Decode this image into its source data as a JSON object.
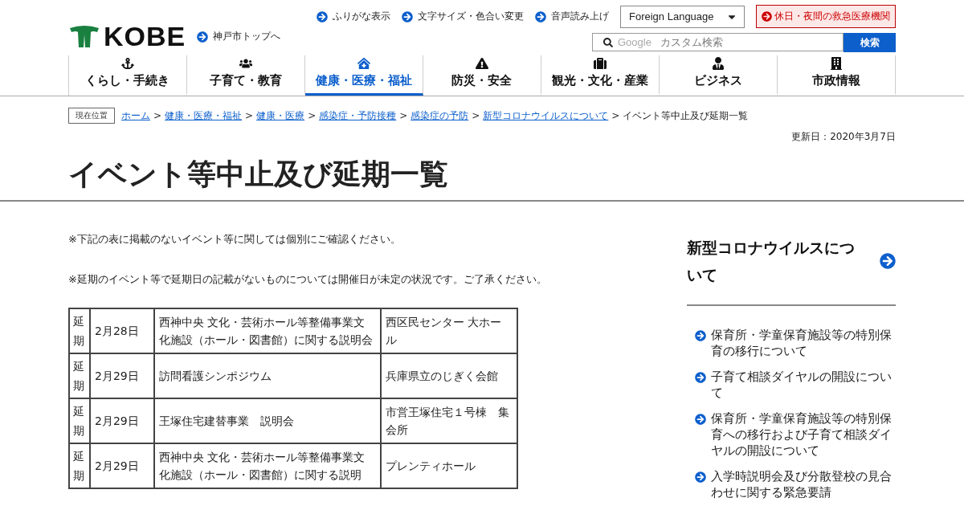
{
  "header": {
    "logo_text": "KOBE",
    "top_link": "神戸市トップへ",
    "utility_links": [
      "ふりがな表示",
      "文字サイズ・色合い変更",
      "音声読み上げ"
    ],
    "language_select": "Foreign Language",
    "emergency_button": "休日・夜間の救急医療機関",
    "search": {
      "brand": "Google",
      "placeholder": "カスタム検索",
      "button": "検索"
    }
  },
  "nav": [
    {
      "label": "くらし・手続き",
      "selected": false
    },
    {
      "label": "子育て・教育",
      "selected": false
    },
    {
      "label": "健康・医療・福祉",
      "selected": true
    },
    {
      "label": "防災・安全",
      "selected": false
    },
    {
      "label": "観光・文化・産業",
      "selected": false
    },
    {
      "label": "ビジネス",
      "selected": false
    },
    {
      "label": "市政情報",
      "selected": false
    }
  ],
  "breadcrumb": {
    "label": "現在位置",
    "separator": ">",
    "links": [
      "ホーム",
      "健康・医療・福祉",
      "健康・医療",
      "感染症・予防接種",
      "感染症の予防",
      "新型コロナウイルスについて"
    ],
    "current": "イベント等中止及び延期一覧"
  },
  "updated": "更新日：2020年3月7日",
  "title": "イベント等中止及び延期一覧",
  "notes": [
    "※下記の表に掲載のないイベント等に関しては個別にご確認ください。",
    "※延期のイベント等で延期日の記載がないものについては開催日が未定の状況です。ご了承ください。"
  ],
  "table": {
    "rows": [
      {
        "status": "延期",
        "date": "2月28日",
        "event": "西神中央 文化・芸術ホール等整備事業文化施設（ホール・図書館）に関する説明会",
        "venue": "西区民センター 大ホール"
      },
      {
        "status": "延期",
        "date": "2月29日",
        "event": "訪問看護シンポジウム",
        "venue": "兵庫県立のじぎく会館"
      },
      {
        "status": "延期",
        "date": "2月29日",
        "event": "王塚住宅建替事業　説明会",
        "venue": "市営王塚住宅１号棟　集会所"
      },
      {
        "status": "延期",
        "date": "2月29日",
        "event": "西神中央 文化・芸術ホール等整備事業文化施設（ホール・図書館）に関する説明",
        "venue": "プレンティホール"
      }
    ]
  },
  "sidebar": {
    "heading": "新型コロナウイルスについて",
    "links": [
      "保育所・学童保育施設等の特別保育の移行について",
      "子育て相談ダイヤルの開設について",
      "保育所・学童保育施設等の特別保育への移行および子育て相談ダイヤルの開設について",
      "入学時説明会及び分散登校の見合わせに関する緊急要請"
    ]
  }
}
